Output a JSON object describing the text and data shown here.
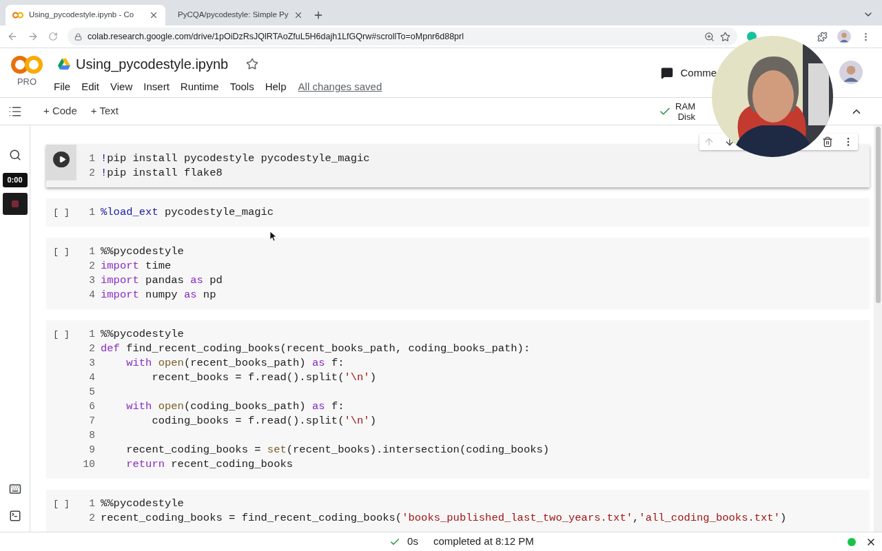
{
  "browser": {
    "tabs": [
      {
        "title": "Using_pycodestyle.ipynb - Co",
        "selected": true
      },
      {
        "title": "PyCQA/pycodestyle: Simple Py",
        "selected": false
      }
    ],
    "url": "colab.research.google.com/drive/1pOiDzRsJQlRTAoZfuL5H6dajh1LfGQrw#scrollTo=oMpnr6d88prl"
  },
  "header": {
    "logo_badge": "PRO",
    "title": "Using_pycodestyle.ipynb",
    "menu": [
      "File",
      "Edit",
      "View",
      "Insert",
      "Runtime",
      "Tools",
      "Help"
    ],
    "save_status": "All changes saved",
    "comment_label": "Comme"
  },
  "toolbar": {
    "buttons": [
      "+ Code",
      "+ Text"
    ],
    "resources": [
      "RAM",
      "Disk"
    ]
  },
  "recording": {
    "timer": "0:00"
  },
  "cells": [
    {
      "selected": true,
      "lines": [
        {
          "number": "1",
          "tokens": [
            {
              "kind": "magic",
              "text": "!"
            },
            {
              "kind": "plain",
              "text": "pip install pycodestyle pycodestyle_magic"
            }
          ]
        },
        {
          "number": "2",
          "tokens": [
            {
              "kind": "magic",
              "text": "!"
            },
            {
              "kind": "plain",
              "text": "pip install flake8"
            }
          ]
        }
      ]
    },
    {
      "selected": false,
      "prompt": "[ ]",
      "lines": [
        {
          "number": "1",
          "tokens": [
            {
              "kind": "magic",
              "text": "%load_ext"
            },
            {
              "kind": "plain",
              "text": " pycodestyle_magic"
            }
          ]
        }
      ]
    },
    {
      "selected": false,
      "prompt": "[ ]",
      "lines": [
        {
          "number": "1",
          "tokens": [
            {
              "kind": "plain",
              "text": "%%pycodestyle"
            }
          ]
        },
        {
          "number": "2",
          "tokens": [
            {
              "kind": "keyword",
              "text": "import"
            },
            {
              "kind": "plain",
              "text": " time"
            }
          ]
        },
        {
          "number": "3",
          "tokens": [
            {
              "kind": "keyword",
              "text": "import"
            },
            {
              "kind": "plain",
              "text": " pandas "
            },
            {
              "kind": "keyword",
              "text": "as"
            },
            {
              "kind": "plain",
              "text": " pd"
            }
          ]
        },
        {
          "number": "4",
          "tokens": [
            {
              "kind": "keyword",
              "text": "import"
            },
            {
              "kind": "plain",
              "text": " numpy "
            },
            {
              "kind": "keyword",
              "text": "as"
            },
            {
              "kind": "plain",
              "text": " np"
            }
          ]
        }
      ]
    },
    {
      "selected": false,
      "prompt": "[ ]",
      "lines": [
        {
          "number": "1",
          "tokens": [
            {
              "kind": "plain",
              "text": "%%pycodestyle"
            }
          ]
        },
        {
          "number": "2",
          "tokens": [
            {
              "kind": "keyword",
              "text": "def "
            },
            {
              "kind": "function",
              "text": "find_recent_coding_books"
            },
            {
              "kind": "plain",
              "text": "(recent_books_path, coding_books_path):"
            }
          ]
        },
        {
          "number": "3",
          "tokens": [
            {
              "kind": "keyword",
              "text": "    with "
            },
            {
              "kind": "builtin",
              "text": "open"
            },
            {
              "kind": "plain",
              "text": "(recent_books_path) "
            },
            {
              "kind": "keyword",
              "text": "as"
            },
            {
              "kind": "plain",
              "text": " f:"
            }
          ]
        },
        {
          "number": "4",
          "tokens": [
            {
              "kind": "plain",
              "text": "        recent_books = f.read().split("
            },
            {
              "kind": "string",
              "text": "'\\n'"
            },
            {
              "kind": "plain",
              "text": ")"
            }
          ]
        },
        {
          "number": "5"
        },
        {
          "number": "6",
          "tokens": [
            {
              "kind": "keyword",
              "text": "    with "
            },
            {
              "kind": "builtin",
              "text": "open"
            },
            {
              "kind": "plain",
              "text": "(coding_books_path) "
            },
            {
              "kind": "keyword",
              "text": "as"
            },
            {
              "kind": "plain",
              "text": " f:"
            }
          ]
        },
        {
          "number": "7",
          "tokens": [
            {
              "kind": "plain",
              "text": "        coding_books = f.read().split("
            },
            {
              "kind": "string",
              "text": "'\\n'"
            },
            {
              "kind": "plain",
              "text": ")"
            }
          ]
        },
        {
          "number": "8"
        },
        {
          "number": "9",
          "tokens": [
            {
              "kind": "plain",
              "text": "    recent_coding_books = "
            },
            {
              "kind": "builtin",
              "text": "set"
            },
            {
              "kind": "plain",
              "text": "(recent_books).intersection(coding_books)"
            }
          ]
        },
        {
          "number": "10",
          "tokens": [
            {
              "kind": "keyword",
              "text": "    return"
            },
            {
              "kind": "plain",
              "text": " recent_coding_books"
            }
          ]
        }
      ]
    },
    {
      "selected": false,
      "prompt": "[ ]",
      "lines": [
        {
          "number": "1",
          "tokens": [
            {
              "kind": "plain",
              "text": "%%pycodestyle"
            }
          ]
        },
        {
          "number": "2",
          "tokens": [
            {
              "kind": "plain",
              "text": "recent_coding_books = find_recent_coding_books("
            },
            {
              "kind": "string",
              "text": "'books_published_last_two_years.txt'"
            },
            {
              "kind": "plain",
              "text": ","
            },
            {
              "kind": "string",
              "text": "'all_coding_books.txt'"
            },
            {
              "kind": "plain",
              "text": ")"
            }
          ]
        }
      ]
    }
  ],
  "status_bar": {
    "duration": "0s",
    "message": "completed at 8:12 PM"
  }
}
